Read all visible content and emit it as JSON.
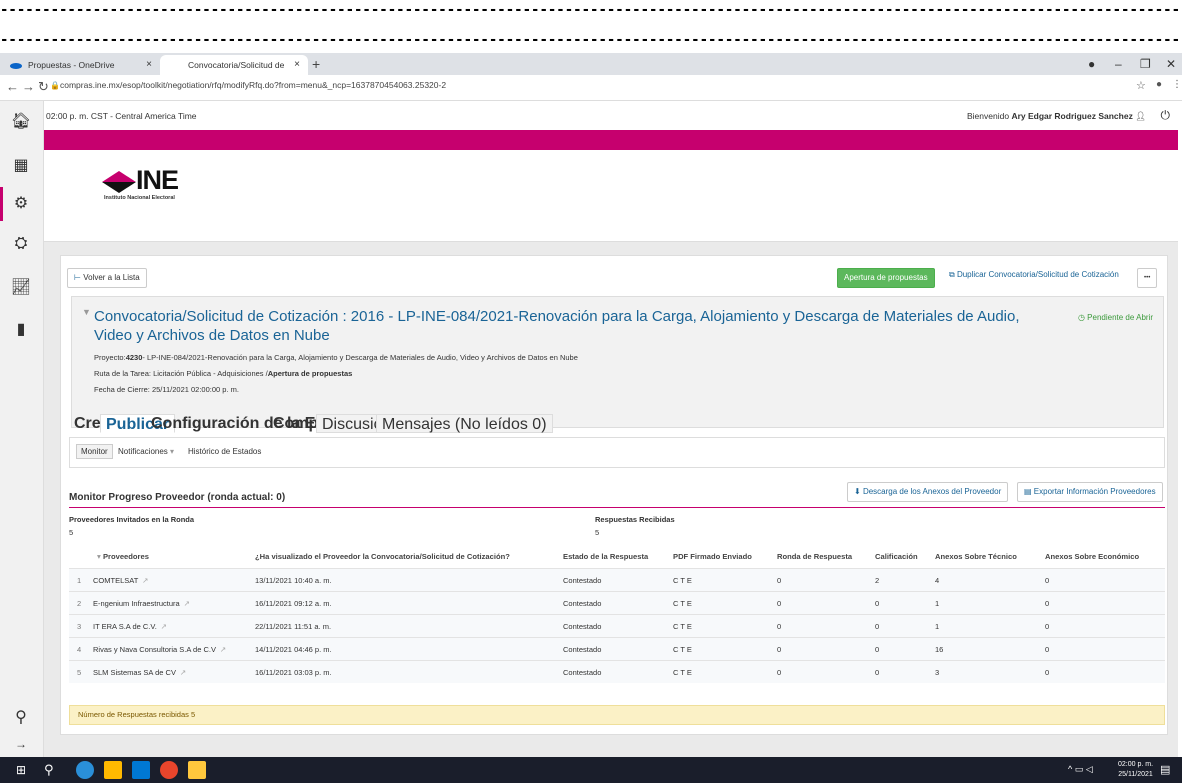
{
  "browser": {
    "tabs": [
      {
        "title": "Propuestas - OneDrive",
        "close": "×"
      },
      {
        "title": "Convocatoria/Solicitud de Cotiz…",
        "close": "×"
      }
    ],
    "new_tab": "+",
    "url": "compras.ine.mx/esop/toolkit/negotiation/rfq/modifyRfq.do?from=menu&_ncp=1637870454063.25320-2"
  },
  "header": {
    "time": "02:00 p. m. CST - Central America Time",
    "welcome": "Bienvenido",
    "user": "Ary Edgar Rodriguez Sanchez"
  },
  "logo": {
    "mark": "INE",
    "subtitle": "Instituto Nacional Electoral"
  },
  "actions": {
    "back": "Volver a la Lista",
    "apertura": "Apertura de propuestas",
    "duplicar": "Duplicar Convocatoria/Solicitud de Cotización",
    "more": "•••"
  },
  "detail": {
    "title": "Convocatoria/Solicitud de Cotización : 2016 - LP-INE-084/2021-Renovación para la Carga, Alojamiento y Descarga de Materiales de Audio, Video y Archivos de Datos en Nube",
    "status": "Pendiente de Abrir",
    "proyecto_label": "Proyecto:",
    "proyecto_code": "4230",
    "proyecto_text": "- LP-INE-084/2021-Renovación para la Carga, Alojamiento y Descarga de Materiales de Audio, Video y Archivos de Datos en Nube",
    "ruta_label": "Ruta de la Tarea: Licitación Pública - Adquisiciones /",
    "ruta_value": "Apertura de propuestas",
    "cierre": "Fecha de Cierre: 25/11/2021 02:00:00 p. m."
  },
  "tabs": [
    "Crear",
    "Publicar",
    "Configuración de la Evaluación",
    "Completar",
    "Discusiones",
    "Mensajes (No leídos 0)"
  ],
  "subtabs": [
    "Monitor",
    "Notificaciones",
    "Histórico de Estados"
  ],
  "monitor": {
    "title": "Monitor Progreso Proveedor (ronda actual: 0)",
    "download": "Descarga de los Anexos del Proveedor",
    "export": "Exportar Información Proveedores",
    "invitados_label": "Proveedores Invitados en la Ronda",
    "invitados_value": "5",
    "respuestas_label": "Respuestas Recibidas",
    "respuestas_value": "5"
  },
  "table": {
    "headers": [
      "Proveedores",
      "¿Ha visualizado el Proveedor la Convocatoria/Solicitud de Cotización?",
      "Estado de la Respuesta",
      "PDF Firmado Enviado",
      "Ronda de Respuesta",
      "Calificación",
      "Anexos Sobre Técnico",
      "Anexos Sobre Económico"
    ],
    "rows": [
      {
        "n": "1",
        "proveedor": "COMTELSAT",
        "visto": "13/11/2021 10:40 a. m.",
        "estado": "Contestado",
        "pdf": "C T E",
        "ronda": "0",
        "calif": "2",
        "tecnico": "4",
        "economico": "0"
      },
      {
        "n": "2",
        "proveedor": "E-ngenium Infraestructura",
        "visto": "16/11/2021 09:12 a. m.",
        "estado": "Contestado",
        "pdf": "C T E",
        "ronda": "0",
        "calif": "0",
        "tecnico": "1",
        "economico": "0"
      },
      {
        "n": "3",
        "proveedor": "IT ERA S.A de C.V.",
        "visto": "22/11/2021 11:51 a. m.",
        "estado": "Contestado",
        "pdf": "C T E",
        "ronda": "0",
        "calif": "0",
        "tecnico": "1",
        "economico": "0"
      },
      {
        "n": "4",
        "proveedor": "Rivas y Nava Consultoria S.A de C.V",
        "visto": "14/11/2021 04:46 p. m.",
        "estado": "Contestado",
        "pdf": "C T E",
        "ronda": "0",
        "calif": "0",
        "tecnico": "16",
        "economico": "0"
      },
      {
        "n": "5",
        "proveedor": "SLM Sistemas SA de CV",
        "visto": "16/11/2021 03:03 p. m.",
        "estado": "Contestado",
        "pdf": "C T E",
        "ronda": "0",
        "calif": "0",
        "tecnico": "3",
        "economico": "0"
      }
    ],
    "footer": "Número de Respuestas recibidas 5"
  },
  "taskbar": {
    "time": "02:00 p. m.",
    "date": "25/11/2021"
  },
  "colors": {
    "brand": "#c6006e",
    "green": "#5cb85c",
    "link": "#1a6496"
  }
}
